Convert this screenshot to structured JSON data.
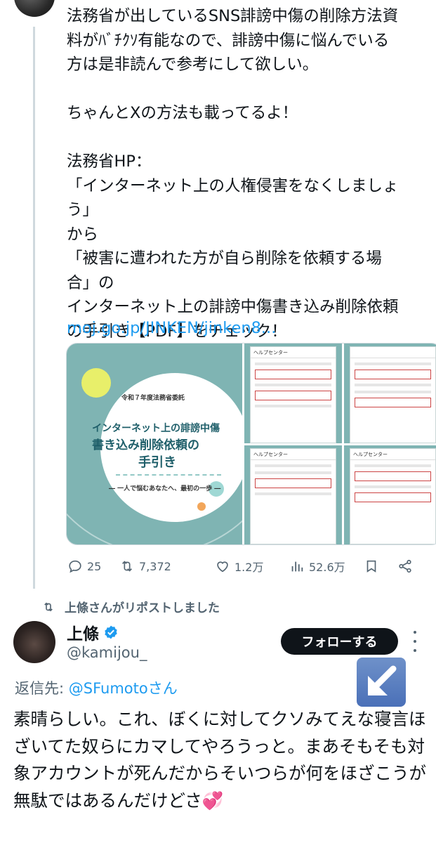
{
  "tweet1": {
    "text": "法務省が出しているSNS誹謗中傷の削除方法資\n料がﾊﾞﾁｸｿ有能なので、誹謗中傷に悩んでいる\n方は是非読んで参考にして欲しい。\n\nちゃんとXの方法も載ってるよ！\n\n法務省HP：\n「インターネット上の人権侵害をなくしましょ\nう」\nから\n「被害に遭われた方が自ら削除を依頼する場\n合」の\nインターネット上の誹謗中傷書き込み削除依頼\nの手引き【PDF】をチェック！",
    "link": "moj.go.jp/JINKEN/jinken8...",
    "media": {
      "cover": {
        "supertitle": "令和７年度法務省委託",
        "line1": "インターネット上の誹謗中傷",
        "line2": "書き込み削除依頼の",
        "line3": "手引き",
        "subtitle": "― 一人で悩むあなたへ、最初の一歩 ―"
      },
      "screens": [
        {
          "bar": "ヘルプセンター"
        },
        {
          "bar": ""
        },
        {
          "bar": "ヘルプセンター"
        },
        {
          "bar": "ヘルプセンター"
        }
      ]
    },
    "stats": {
      "replies": "25",
      "reposts": "7,372",
      "likes": "1.2万",
      "views": "52.6万"
    }
  },
  "repost_header": "上條さんがリポストしました",
  "tweet2": {
    "name": "上條",
    "handle": "@kamijou_",
    "follow_label": "フォローする",
    "reply_prefix": "返信先: ",
    "reply_mention": "@SFumotoさん",
    "text": "素晴らしい。これ、ぼくに対してクソみてえな寝言ほざいてた奴らにカマしてやろうっと。まあそもそも対象アカウントが死んだからそいつらが何をほざこうが無駄ではあるんだけどさ💞"
  },
  "colors": {
    "accent": "#1d9bf0",
    "muted": "#536471",
    "cover_teal": "#7fb4b3"
  }
}
